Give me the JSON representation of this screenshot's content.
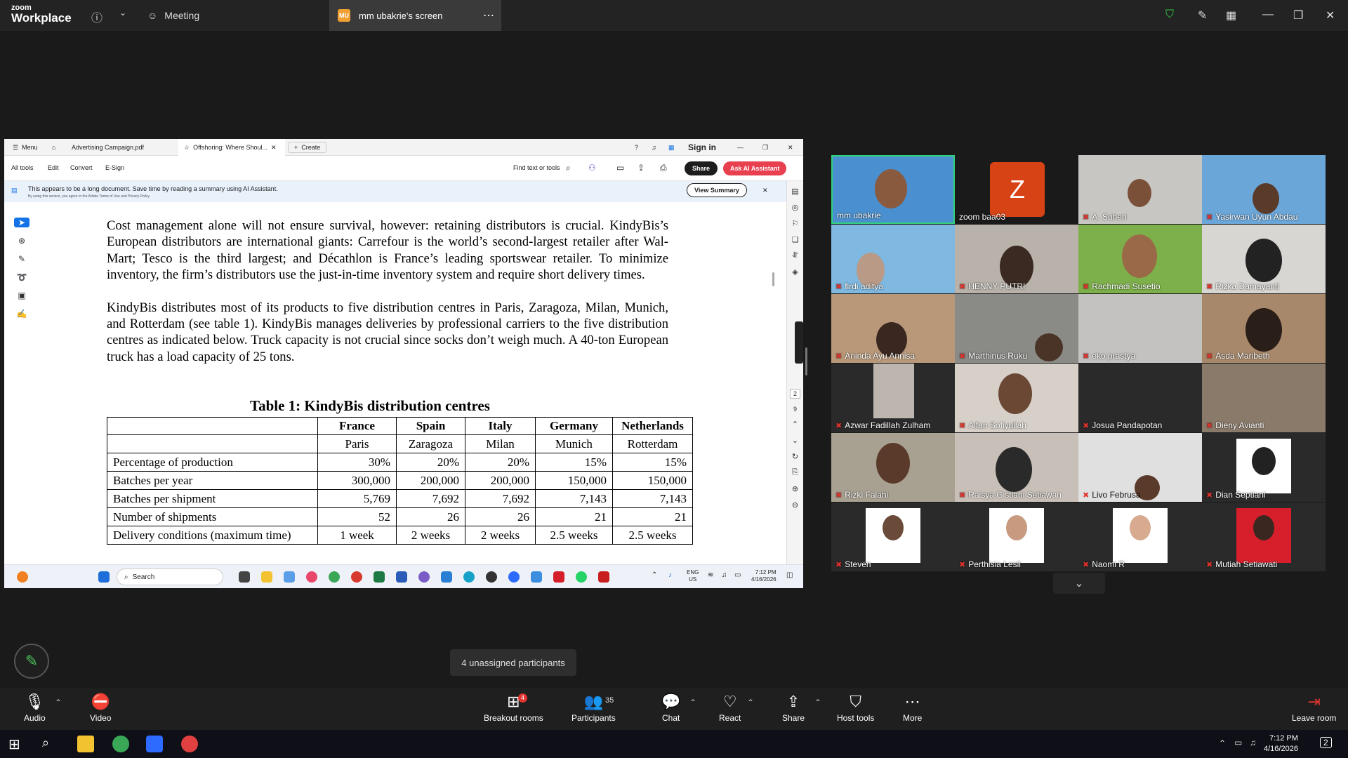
{
  "zoom": {
    "logo_line1": "zoom",
    "logo_line2": "Workplace",
    "meeting_tab": "Meeting",
    "screen_badge": "MU",
    "screen_tab": "mm ubakrie's screen"
  },
  "acrobat": {
    "menu": "Menu",
    "tab1": "Advertising Campaign.pdf",
    "tab2": "Offshoring: Where Shoul...",
    "create": "Create",
    "sign_in": "Sign in",
    "toolbar": [
      "All tools",
      "Edit",
      "Convert",
      "E-Sign"
    ],
    "find": "Find text or tools",
    "share": "Share",
    "ai": "Ask AI Assistant",
    "banner": "This appears to be a long document. Save time by reading a summary using AI Assistant.",
    "banner_small": "By using this service, you agree to the Adobe Terms of Use and Privacy Policy.",
    "view_summary": "View Summary",
    "page_num": "2",
    "page_total": "9"
  },
  "document": {
    "para1": "Cost management alone will not ensure survival, however: retaining distributors is crucial. KindyBis’s European distributors are international giants: Carrefour is the world’s second-largest retailer after Wal-Mart; Tesco is the third largest; and Décathlon is France’s leading sportswear retailer. To minimize inventory, the firm’s distributors use the just-in-time inventory system and require short delivery times.",
    "para2": "KindyBis distributes most of its products to five distribution centres in Paris, Zaragoza, Milan, Munich, and Rotterdam (see table 1). KindyBis manages deliveries by professional carriers to the five distribution centres as indicated below. Truck capacity is not crucial since socks don’t weigh much. A 40-ton European truck has a load capacity of 25 tons.",
    "table_title": "Table 1: KindyBis distribution centres",
    "countries": [
      "France",
      "Spain",
      "Italy",
      "Germany",
      "Netherlands"
    ],
    "cities": [
      "Paris",
      "Zaragoza",
      "Milan",
      "Munich",
      "Rotterdam"
    ],
    "rows": [
      {
        "label": "Percentage of production",
        "values": [
          "30%",
          "20%",
          "20%",
          "15%",
          "15%"
        ]
      },
      {
        "label": "Batches per year",
        "values": [
          "300,000",
          "200,000",
          "200,000",
          "150,000",
          "150,000"
        ]
      },
      {
        "label": "Batches per shipment",
        "values": [
          "5,769",
          "7,692",
          "7,692",
          "7,143",
          "7,143"
        ]
      },
      {
        "label": "Number of shipments",
        "values": [
          "52",
          "26",
          "26",
          "21",
          "21"
        ]
      },
      {
        "label": "Delivery conditions (maximum time)",
        "values": [
          "1 week",
          "2 weeks",
          "2 weeks",
          "2.5 weeks",
          "2.5 weeks"
        ]
      }
    ]
  },
  "inner_taskbar": {
    "search": "Search",
    "lang1": "ENG",
    "lang2": "US",
    "time": "7:12 PM",
    "date": "4/16/2026"
  },
  "participants": [
    {
      "name": "mm ubakrie",
      "muted": false
    },
    {
      "name": "zoom baa03",
      "muted": false,
      "initial": "Z"
    },
    {
      "name": "A. Suheri",
      "muted": true
    },
    {
      "name": "Yasirwan Uyun Abdau",
      "muted": true
    },
    {
      "name": "firdi aditya",
      "muted": true
    },
    {
      "name": "HENNY PUTRI",
      "muted": true
    },
    {
      "name": "Rachmadi Susetio",
      "muted": true
    },
    {
      "name": "Rizka Damayanti",
      "muted": true
    },
    {
      "name": "Aninda Ayu Annisa",
      "muted": true
    },
    {
      "name": "Marthinus Ruku",
      "muted": true
    },
    {
      "name": "eko prastya",
      "muted": true
    },
    {
      "name": "Asda Maribeth",
      "muted": true
    },
    {
      "name": "Azwar Fadillah Zulham",
      "muted": true
    },
    {
      "name": "Alfan Sofiyullah",
      "muted": true
    },
    {
      "name": "Josua Pandapotan",
      "muted": true
    },
    {
      "name": "Dieny Avianti",
      "muted": true
    },
    {
      "name": "Rizki Falahi",
      "muted": true
    },
    {
      "name": "Raisya Gistiani Setiawan",
      "muted": true
    },
    {
      "name": "Livo Februsa",
      "muted": true
    },
    {
      "name": "Dian Septiani",
      "muted": true
    },
    {
      "name": "Steven",
      "muted": true
    },
    {
      "name": "Perthisia Lesli",
      "muted": true
    },
    {
      "name": "Naomi R",
      "muted": true
    },
    {
      "name": "Mutiah Setiawati",
      "muted": true
    }
  ],
  "tooltip": "4 unassigned participants",
  "controls": {
    "audio": "Audio",
    "video": "Video",
    "breakout": "Breakout rooms",
    "breakout_badge": "4",
    "participants": "Participants",
    "participants_count": "35",
    "chat": "Chat",
    "react": "React",
    "share": "Share",
    "host_tools": "Host tools",
    "more": "More",
    "leave": "Leave room"
  },
  "win_taskbar": {
    "time": "7:12 PM",
    "date": "4/16/2026",
    "notif": "2"
  },
  "colors": {
    "zoom_green": "#4cc05a",
    "acrobat_red": "#e8404f",
    "mute_red": "#e0342f"
  }
}
